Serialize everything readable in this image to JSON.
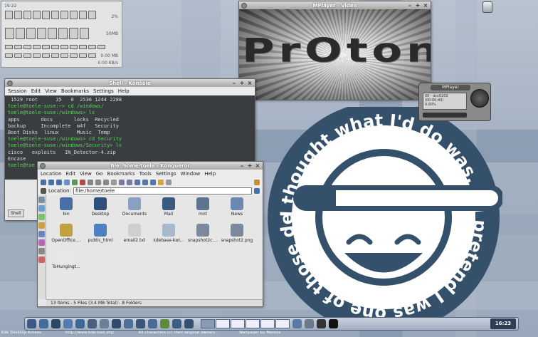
{
  "sysmon": {
    "time": "19:22",
    "cpu_pct": "2%",
    "mem": "50MB",
    "row3_label": "0.00 MB",
    "row4_label": "0.00 KB/s"
  },
  "video": {
    "title": "MPlayer - Video",
    "logo_text": "PrOton"
  },
  "konsole": {
    "title": "Shell - Konsole",
    "menu": [
      "Session",
      "Edit",
      "View",
      "Bookmarks",
      "Settings",
      "Help"
    ],
    "lines": [
      {
        "text": " 1529 root      35   0  2536 1244 2288",
        "prompt": false
      },
      {
        "text": "toele@toele-suse:~> cd /windows/",
        "prompt": true
      },
      {
        "text": "toele@toele-suse:/windows> ls",
        "prompt": true
      },
      {
        "text": "apps       docs       locks  Recycled",
        "prompt": false
      },
      {
        "text": "backup     Incomplete  m4f   Security",
        "prompt": false
      },
      {
        "text": "Boot Disks  linux      Music  Temp",
        "prompt": false
      },
      {
        "text": "toele@toele-suse:/windows> cd Security",
        "prompt": true
      },
      {
        "text": "toele@toele-suse:/windows/Security> ls",
        "prompt": true
      },
      {
        "text": "cisco   exploits   IN_Detector-4.zip",
        "prompt": false
      },
      {
        "text": "Encase",
        "prompt": false
      },
      {
        "text": "toele@toe",
        "prompt": true
      }
    ],
    "tab_label": "Shell"
  },
  "konqueror": {
    "title": "file:/home/toele - Konqueror",
    "menu": [
      "Location",
      "Edit",
      "View",
      "Go",
      "Bookmarks",
      "Tools",
      "Settings",
      "Window",
      "Help"
    ],
    "location_label": "Location:",
    "location_value": "file:/home/toele",
    "files": [
      "bin",
      "Desktop",
      "Documents",
      "Mail",
      "mnt",
      "News",
      "OpenOffice....",
      "public_html",
      "email2.txt",
      "kdebase-kwi...",
      "snapshot2c....",
      "snapshot2.png",
      "ToHungingt..."
    ],
    "status": "13 Items - 5 Files (3.4 MB Total) - 8 Folders"
  },
  "mplayer": {
    "title": "MPlayer",
    "line1": "00 - dcc0202 (00:00:40)",
    "line2": "0.00%"
  },
  "wallpaper": {
    "ring_text": "I thought what I'd do was, I'd pretend I was one of those deaf-mutes "
  },
  "taskbar": {
    "clock": "16:23"
  },
  "credits": [
    "Kde Desktop Antaes",
    "http://www.kde-look.org/",
    "All characters (c) their original owners",
    "Wallpaper by Mentos"
  ],
  "colors": {
    "ring": "#34506b",
    "term_bg": "#3a3d40",
    "term_prompt": "#5fd35f"
  }
}
